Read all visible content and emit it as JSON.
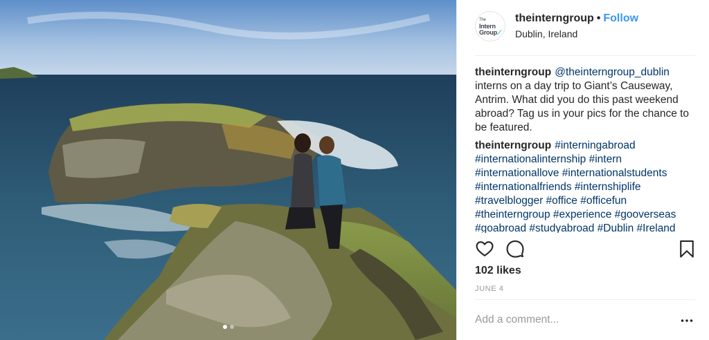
{
  "post": {
    "username": "theinterngroup",
    "separator": "•",
    "follow_label": "Follow",
    "location": "Dublin, Ireland",
    "avatar_logo": {
      "line1": "The",
      "line2": "Intern",
      "line3": "Group"
    },
    "comments": [
      {
        "user": "theinterngroup",
        "mention": "@theinterngroup_dublin",
        "text": " interns on a day trip to Giant’s Causeway, Antrim. What did you do this past weekend abroad? Tag us in your pics for the chance to be featured."
      },
      {
        "user": "theinterngroup",
        "hashtags": "#interningabroad #internationalinternship #intern #internationallove #internationalstudents #internationalfriends #internshiplife #travelblogger #office #officefun #theinterngroup #experience #gooverseas #goabroad #studyabroad #Dublin #Ireland"
      }
    ],
    "likes": "102 likes",
    "date": "JUNE 4",
    "add_comment_placeholder": "Add a comment...",
    "carousel": {
      "count": 2,
      "active": 1
    }
  },
  "icons": {
    "like": "heart-icon",
    "comment": "comment-bubble-icon",
    "save": "bookmark-icon",
    "more": "ellipsis-icon"
  },
  "colors": {
    "link": "#003569",
    "follow": "#3897f0",
    "muted": "#999999",
    "text": "#262626",
    "border": "#efefef"
  }
}
